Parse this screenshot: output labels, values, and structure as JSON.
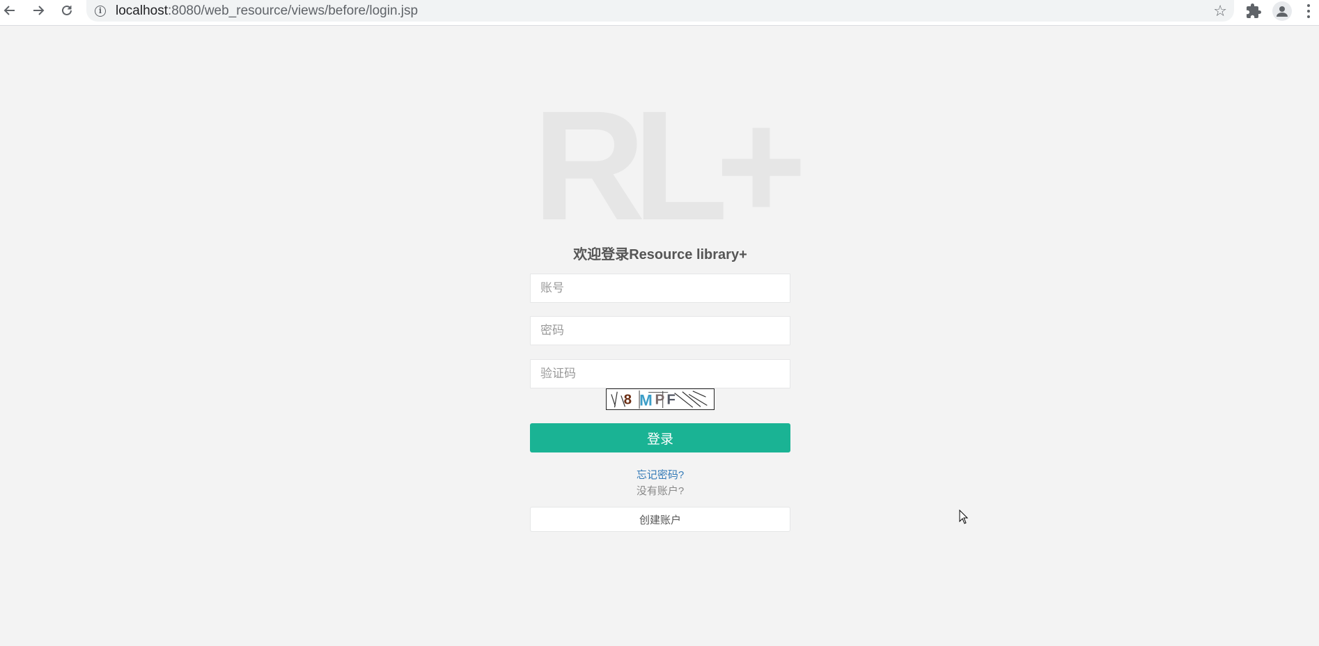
{
  "browser": {
    "url_host": "localhost",
    "url_path": ":8080/web_resource/views/before/login.jsp",
    "back_icon": "arrow-left",
    "forward_icon": "arrow-right",
    "reload_icon": "reload",
    "bookmark_icon": "star-outline",
    "extensions_icon": "puzzle-piece",
    "profile_icon": "account-circle",
    "menu_icon": "three-dots-vertical"
  },
  "page": {
    "logo_text": "RL+",
    "title": "欢迎登录Resource library+",
    "username_placeholder": "账号",
    "password_placeholder": "密码",
    "captcha_placeholder": "验证码",
    "captcha_text": "8MPF",
    "login_label": "登录",
    "forgot_label": "忘记密码?",
    "no_account_label": "没有账户?",
    "create_label": "创建账户"
  },
  "colors": {
    "primary": "#1ab394",
    "link": "#337ab7",
    "background": "#f3f3f3",
    "logo": "#e6e6e6"
  }
}
